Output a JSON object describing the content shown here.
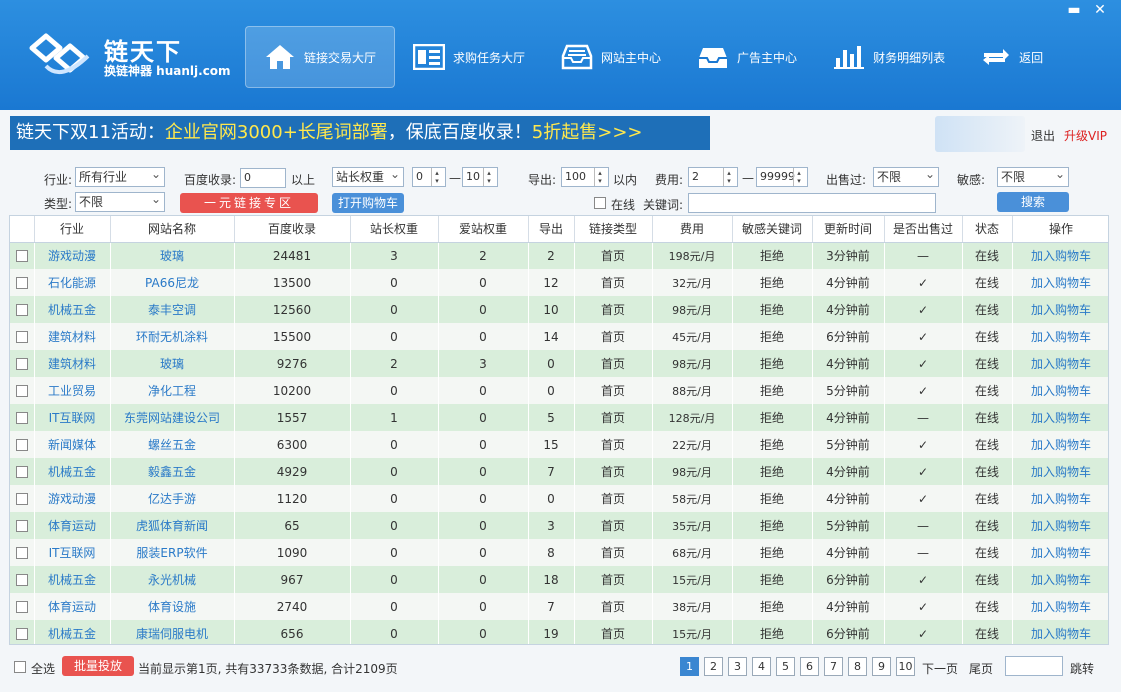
{
  "app": {
    "name": "链天下",
    "tagline": "换链神器 huanlj.com",
    "colors": {
      "header": "#1a78d2",
      "accent": "#2a7ac8",
      "danger": "#e9534f",
      "row_green": "#d9eedb"
    }
  },
  "window": {
    "minimize": "▬",
    "close": "✕"
  },
  "nav": [
    {
      "label": "链接交易大厅",
      "icon": "home-icon",
      "active": true
    },
    {
      "label": "求购任务大厅",
      "icon": "task-list-icon",
      "active": false
    },
    {
      "label": "网站主中心",
      "icon": "inbox-tray-icon",
      "active": false
    },
    {
      "label": "广告主中心",
      "icon": "advert-tray-icon",
      "active": false
    },
    {
      "label": "财务明细列表",
      "icon": "bar-chart-icon",
      "active": false
    },
    {
      "label": "返回",
      "icon": "return-arrows-icon",
      "active": false
    }
  ],
  "banner": {
    "prefix": "链天下双11活动：",
    "highlight": "企业官网3000+长尾词部署",
    "middle": "，保底百度收录！",
    "highlight2": "5折起售>>>"
  },
  "user": {
    "logout": "退出",
    "upgrade": "升级VIP"
  },
  "filters": {
    "industry_label": "行业:",
    "industry_value": "所有行业",
    "type_label": "类型:",
    "type_value": "不限",
    "baidu_label": "百度收录:",
    "baidu_value": "0",
    "baidu_suffix": "以上",
    "weight_select": "站长权重",
    "weight_from": "0",
    "weight_dash": "—",
    "weight_to": "10",
    "export_label": "导出:",
    "export_value": "100",
    "export_suffix": "以内",
    "fee_label": "费用:",
    "fee_from": "2",
    "fee_dash": "—",
    "fee_to": "99999",
    "sold_label": "出售过:",
    "sold_value": "不限",
    "sensitive_label": "敏感:",
    "sensitive_value": "不限",
    "promo_button": "一元链接专区",
    "cart_button": "打开购物车",
    "online_label": "在线",
    "keyword_label": "关键词:",
    "search_button": "搜索"
  },
  "table": {
    "headers": [
      "行业",
      "网站名称",
      "百度收录",
      "站长权重",
      "爱站权重",
      "导出",
      "链接类型",
      "费用",
      "敏感关键词",
      "更新时间",
      "是否出售过",
      "状态",
      "操作"
    ],
    "rows": [
      [
        "游戏动漫",
        "玻璃",
        "24481",
        "3",
        "2",
        "2",
        "首页",
        "198元/月",
        "拒绝",
        "3分钟前",
        "—",
        "在线",
        "加入购物车"
      ],
      [
        "石化能源",
        "PA66尼龙",
        "13500",
        "0",
        "0",
        "12",
        "首页",
        "32元/月",
        "拒绝",
        "4分钟前",
        "✓",
        "在线",
        "加入购物车"
      ],
      [
        "机械五金",
        "泰丰空调",
        "12560",
        "0",
        "0",
        "10",
        "首页",
        "98元/月",
        "拒绝",
        "4分钟前",
        "✓",
        "在线",
        "加入购物车"
      ],
      [
        "建筑材料",
        "环耐无机涂料",
        "15500",
        "0",
        "0",
        "14",
        "首页",
        "45元/月",
        "拒绝",
        "6分钟前",
        "✓",
        "在线",
        "加入购物车"
      ],
      [
        "建筑材料",
        "玻璃",
        "9276",
        "2",
        "3",
        "0",
        "首页",
        "98元/月",
        "拒绝",
        "4分钟前",
        "✓",
        "在线",
        "加入购物车"
      ],
      [
        "工业贸易",
        "净化工程",
        "10200",
        "0",
        "0",
        "0",
        "首页",
        "88元/月",
        "拒绝",
        "5分钟前",
        "✓",
        "在线",
        "加入购物车"
      ],
      [
        "IT互联网",
        "东莞网站建设公司",
        "1557",
        "1",
        "0",
        "5",
        "首页",
        "128元/月",
        "拒绝",
        "4分钟前",
        "—",
        "在线",
        "加入购物车"
      ],
      [
        "新闻媒体",
        "螺丝五金",
        "6300",
        "0",
        "0",
        "15",
        "首页",
        "22元/月",
        "拒绝",
        "5分钟前",
        "✓",
        "在线",
        "加入购物车"
      ],
      [
        "机械五金",
        "毅鑫五金",
        "4929",
        "0",
        "0",
        "7",
        "首页",
        "98元/月",
        "拒绝",
        "4分钟前",
        "✓",
        "在线",
        "加入购物车"
      ],
      [
        "游戏动漫",
        "亿达手游",
        "1120",
        "0",
        "0",
        "0",
        "首页",
        "58元/月",
        "拒绝",
        "4分钟前",
        "✓",
        "在线",
        "加入购物车"
      ],
      [
        "体育运动",
        "虎狐体育新闻",
        "65",
        "0",
        "0",
        "3",
        "首页",
        "35元/月",
        "拒绝",
        "5分钟前",
        "—",
        "在线",
        "加入购物车"
      ],
      [
        "IT互联网",
        "服装ERP软件",
        "1090",
        "0",
        "0",
        "8",
        "首页",
        "68元/月",
        "拒绝",
        "4分钟前",
        "—",
        "在线",
        "加入购物车"
      ],
      [
        "机械五金",
        "永光机械",
        "967",
        "0",
        "0",
        "18",
        "首页",
        "15元/月",
        "拒绝",
        "6分钟前",
        "✓",
        "在线",
        "加入购物车"
      ],
      [
        "体育运动",
        "体育设施",
        "2740",
        "0",
        "0",
        "7",
        "首页",
        "38元/月",
        "拒绝",
        "4分钟前",
        "✓",
        "在线",
        "加入购物车"
      ],
      [
        "机械五金",
        "康瑞伺服电机",
        "656",
        "0",
        "0",
        "19",
        "首页",
        "15元/月",
        "拒绝",
        "6分钟前",
        "✓",
        "在线",
        "加入购物车"
      ]
    ]
  },
  "footer": {
    "select_all": "全选",
    "bulk_button": "批量投放",
    "summary": "当前显示第1页, 共有33733条数据, 合计2109页",
    "pages": [
      "1",
      "2",
      "3",
      "4",
      "5",
      "6",
      "7",
      "8",
      "9",
      "10"
    ],
    "current_page": "1",
    "next": "下一页",
    "last": "尾页",
    "jump": "跳转",
    "jump_value": ""
  }
}
